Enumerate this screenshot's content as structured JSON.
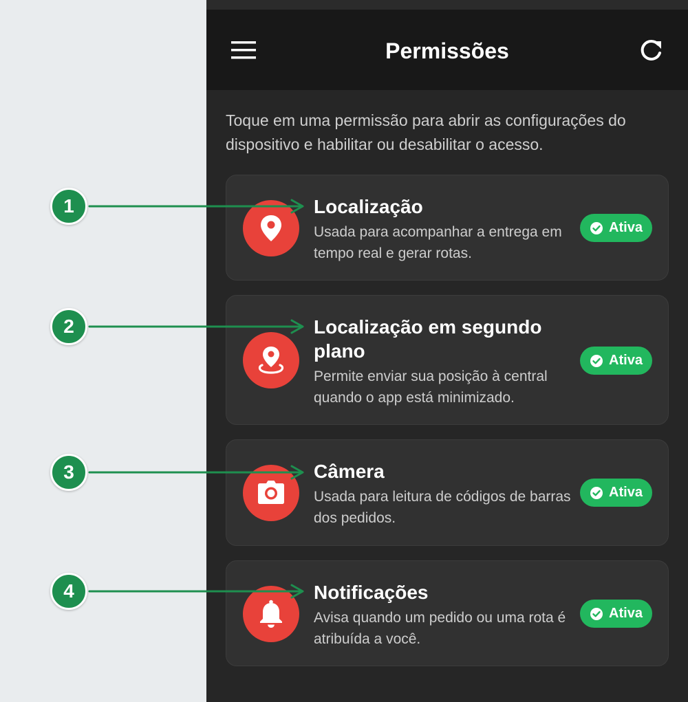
{
  "app": {
    "title": "Permissões",
    "menu_icon": "menu-icon",
    "refresh_icon": "refresh-icon"
  },
  "intro": "Toque em uma permissão para abrir as configurações do dispositivo e habilitar ou desabilitar o acesso.",
  "colors": {
    "background": "#262626",
    "app_bar": "#181818",
    "card": "#313131",
    "icon_circle": "#e8423a",
    "badge": "#22b75e",
    "callout": "#1e8f4f"
  },
  "permissions": [
    {
      "icon": "location-pin-icon",
      "title": "Localização",
      "description": "Usada para acompanhar a entrega em tempo real e gerar rotas.",
      "status": "Ativa"
    },
    {
      "icon": "background-location-icon",
      "title": "Localização em segundo plano",
      "description": "Permite enviar sua posição à central quando o app está minimizado.",
      "status": "Ativa"
    },
    {
      "icon": "camera-icon",
      "title": "Câmera",
      "description": "Usada para leitura de códigos de barras dos pedidos.",
      "status": "Ativa"
    },
    {
      "icon": "bell-icon",
      "title": "Notificações",
      "description": "Avisa quando um pedido ou uma rota é atribuída a você.",
      "status": "Ativa"
    }
  ],
  "callouts": [
    "1",
    "2",
    "3",
    "4"
  ]
}
